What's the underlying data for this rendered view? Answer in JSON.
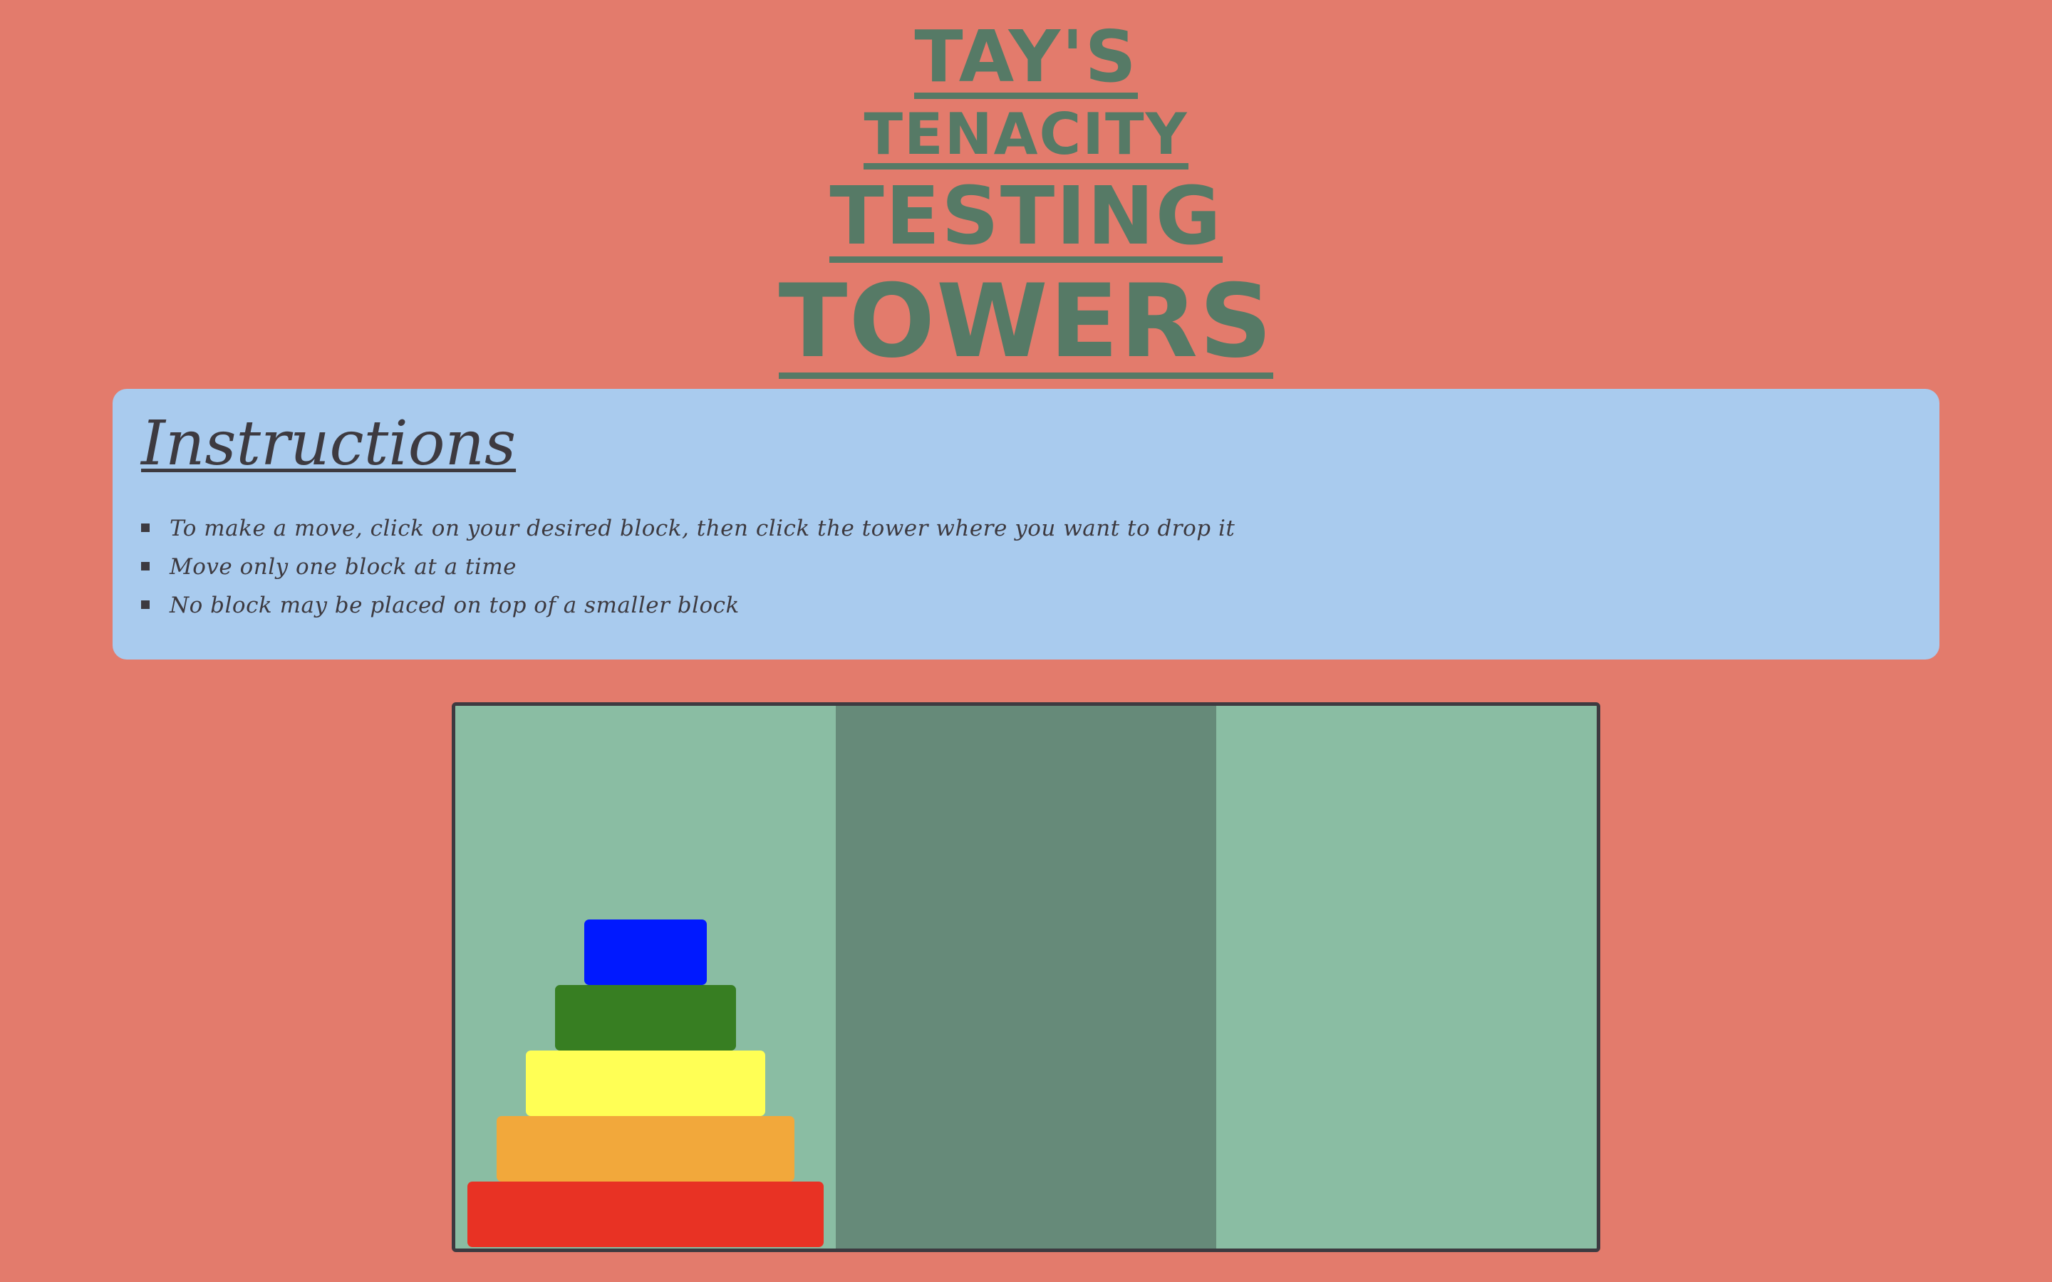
{
  "title": {
    "line1": "Tay's",
    "line2": "Tenacity",
    "line3": "Testing",
    "line4": "Towers"
  },
  "instructions": {
    "heading": "Instructions",
    "items": [
      "To make a move, click on your desired block, then click the tower where you want to drop it",
      "Move only one block at a time",
      "No block may be placed on top of a smaller block"
    ]
  },
  "board": {
    "colors": {
      "tower": "#8abda3",
      "tower_middle": "#668a79",
      "border": "#3d3a40",
      "background": "#e37b6c",
      "instructions_bg": "#a9cbee",
      "title": "#567a66"
    },
    "towers": [
      {
        "blocks": [
          {
            "size": 5,
            "color": "#e83224"
          },
          {
            "size": 4,
            "color": "#f2a83b"
          },
          {
            "size": 3,
            "color": "#ffff55"
          },
          {
            "size": 2,
            "color": "#377e22"
          },
          {
            "size": 1,
            "color": "#0019ff"
          }
        ]
      },
      {
        "blocks": []
      },
      {
        "blocks": []
      }
    ]
  }
}
